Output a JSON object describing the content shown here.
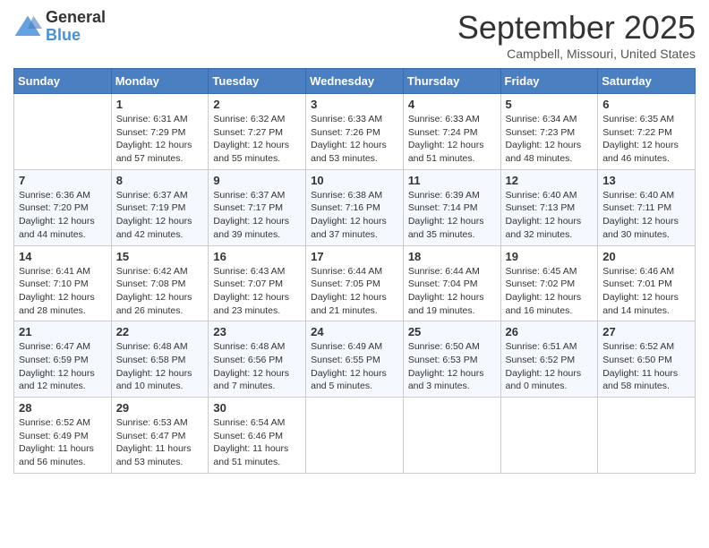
{
  "header": {
    "logo_general": "General",
    "logo_blue": "Blue",
    "month_title": "September 2025",
    "location": "Campbell, Missouri, United States"
  },
  "weekdays": [
    "Sunday",
    "Monday",
    "Tuesday",
    "Wednesday",
    "Thursday",
    "Friday",
    "Saturday"
  ],
  "weeks": [
    [
      {
        "day": "",
        "info": ""
      },
      {
        "day": "1",
        "info": "Sunrise: 6:31 AM\nSunset: 7:29 PM\nDaylight: 12 hours\nand 57 minutes."
      },
      {
        "day": "2",
        "info": "Sunrise: 6:32 AM\nSunset: 7:27 PM\nDaylight: 12 hours\nand 55 minutes."
      },
      {
        "day": "3",
        "info": "Sunrise: 6:33 AM\nSunset: 7:26 PM\nDaylight: 12 hours\nand 53 minutes."
      },
      {
        "day": "4",
        "info": "Sunrise: 6:33 AM\nSunset: 7:24 PM\nDaylight: 12 hours\nand 51 minutes."
      },
      {
        "day": "5",
        "info": "Sunrise: 6:34 AM\nSunset: 7:23 PM\nDaylight: 12 hours\nand 48 minutes."
      },
      {
        "day": "6",
        "info": "Sunrise: 6:35 AM\nSunset: 7:22 PM\nDaylight: 12 hours\nand 46 minutes."
      }
    ],
    [
      {
        "day": "7",
        "info": "Sunrise: 6:36 AM\nSunset: 7:20 PM\nDaylight: 12 hours\nand 44 minutes."
      },
      {
        "day": "8",
        "info": "Sunrise: 6:37 AM\nSunset: 7:19 PM\nDaylight: 12 hours\nand 42 minutes."
      },
      {
        "day": "9",
        "info": "Sunrise: 6:37 AM\nSunset: 7:17 PM\nDaylight: 12 hours\nand 39 minutes."
      },
      {
        "day": "10",
        "info": "Sunrise: 6:38 AM\nSunset: 7:16 PM\nDaylight: 12 hours\nand 37 minutes."
      },
      {
        "day": "11",
        "info": "Sunrise: 6:39 AM\nSunset: 7:14 PM\nDaylight: 12 hours\nand 35 minutes."
      },
      {
        "day": "12",
        "info": "Sunrise: 6:40 AM\nSunset: 7:13 PM\nDaylight: 12 hours\nand 32 minutes."
      },
      {
        "day": "13",
        "info": "Sunrise: 6:40 AM\nSunset: 7:11 PM\nDaylight: 12 hours\nand 30 minutes."
      }
    ],
    [
      {
        "day": "14",
        "info": "Sunrise: 6:41 AM\nSunset: 7:10 PM\nDaylight: 12 hours\nand 28 minutes."
      },
      {
        "day": "15",
        "info": "Sunrise: 6:42 AM\nSunset: 7:08 PM\nDaylight: 12 hours\nand 26 minutes."
      },
      {
        "day": "16",
        "info": "Sunrise: 6:43 AM\nSunset: 7:07 PM\nDaylight: 12 hours\nand 23 minutes."
      },
      {
        "day": "17",
        "info": "Sunrise: 6:44 AM\nSunset: 7:05 PM\nDaylight: 12 hours\nand 21 minutes."
      },
      {
        "day": "18",
        "info": "Sunrise: 6:44 AM\nSunset: 7:04 PM\nDaylight: 12 hours\nand 19 minutes."
      },
      {
        "day": "19",
        "info": "Sunrise: 6:45 AM\nSunset: 7:02 PM\nDaylight: 12 hours\nand 16 minutes."
      },
      {
        "day": "20",
        "info": "Sunrise: 6:46 AM\nSunset: 7:01 PM\nDaylight: 12 hours\nand 14 minutes."
      }
    ],
    [
      {
        "day": "21",
        "info": "Sunrise: 6:47 AM\nSunset: 6:59 PM\nDaylight: 12 hours\nand 12 minutes."
      },
      {
        "day": "22",
        "info": "Sunrise: 6:48 AM\nSunset: 6:58 PM\nDaylight: 12 hours\nand 10 minutes."
      },
      {
        "day": "23",
        "info": "Sunrise: 6:48 AM\nSunset: 6:56 PM\nDaylight: 12 hours\nand 7 minutes."
      },
      {
        "day": "24",
        "info": "Sunrise: 6:49 AM\nSunset: 6:55 PM\nDaylight: 12 hours\nand 5 minutes."
      },
      {
        "day": "25",
        "info": "Sunrise: 6:50 AM\nSunset: 6:53 PM\nDaylight: 12 hours\nand 3 minutes."
      },
      {
        "day": "26",
        "info": "Sunrise: 6:51 AM\nSunset: 6:52 PM\nDaylight: 12 hours\nand 0 minutes."
      },
      {
        "day": "27",
        "info": "Sunrise: 6:52 AM\nSunset: 6:50 PM\nDaylight: 11 hours\nand 58 minutes."
      }
    ],
    [
      {
        "day": "28",
        "info": "Sunrise: 6:52 AM\nSunset: 6:49 PM\nDaylight: 11 hours\nand 56 minutes."
      },
      {
        "day": "29",
        "info": "Sunrise: 6:53 AM\nSunset: 6:47 PM\nDaylight: 11 hours\nand 53 minutes."
      },
      {
        "day": "30",
        "info": "Sunrise: 6:54 AM\nSunset: 6:46 PM\nDaylight: 11 hours\nand 51 minutes."
      },
      {
        "day": "",
        "info": ""
      },
      {
        "day": "",
        "info": ""
      },
      {
        "day": "",
        "info": ""
      },
      {
        "day": "",
        "info": ""
      }
    ]
  ]
}
